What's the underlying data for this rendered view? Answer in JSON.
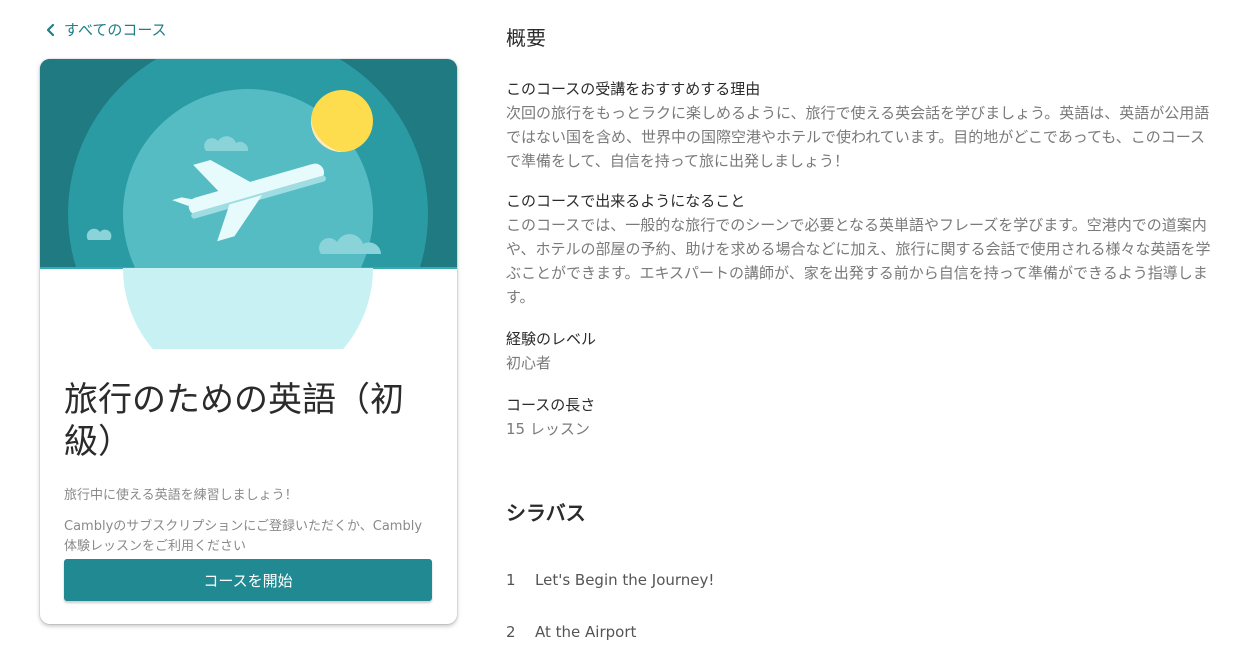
{
  "nav": {
    "back_label": "すべてのコース"
  },
  "course": {
    "title": "旅行のための英語（初級）",
    "subtitle": "旅行中に使える英語を練習しましょう！",
    "note": "Camblyのサブスクリプションにご登録いただくか、Cambly体験レッスンをご利用ください",
    "start_button": "コースを開始",
    "hero_icon": "airplane-illustration"
  },
  "overview": {
    "heading": "概要",
    "sections": [
      {
        "title": "このコースの受講をおすすめする理由",
        "body": "次回の旅行をもっとラクに楽しめるように、旅行で使える英会話を学びましょう。英語は、英語が公用語ではない国を含め、世界中の国際空港やホテルで使われています。目的地がどこであっても、このコースで準備をして、自信を持って旅に出発しましょう！"
      },
      {
        "title": "このコースで出来るようになること",
        "body": "このコースでは、一般的な旅行でのシーンで必要となる英単語やフレーズを学びます。空港内での道案内や、ホテルの部屋の予約、助けを求める場合などに加え、旅行に関する会話で使用される様々な英語を学ぶことができます。エキスパートの講師が、家を出発する前から自信を持って準備ができるよう指導します。"
      },
      {
        "title": "経験のレベル",
        "body": "初心者"
      },
      {
        "title": "コースの長さ",
        "body": "15 レッスン"
      }
    ]
  },
  "syllabus": {
    "heading": "シラバス",
    "items": [
      {
        "num": "1",
        "label": "Let's Begin the Journey!"
      },
      {
        "num": "2",
        "label": "At the Airport"
      }
    ]
  },
  "colors": {
    "accent": "#218991",
    "link": "#1f7e86",
    "hero_dark": "#1b6f78",
    "hero_mid": "#2a9aa2",
    "hero_light": "#c7f1f3",
    "sun": "#fddc4e"
  }
}
